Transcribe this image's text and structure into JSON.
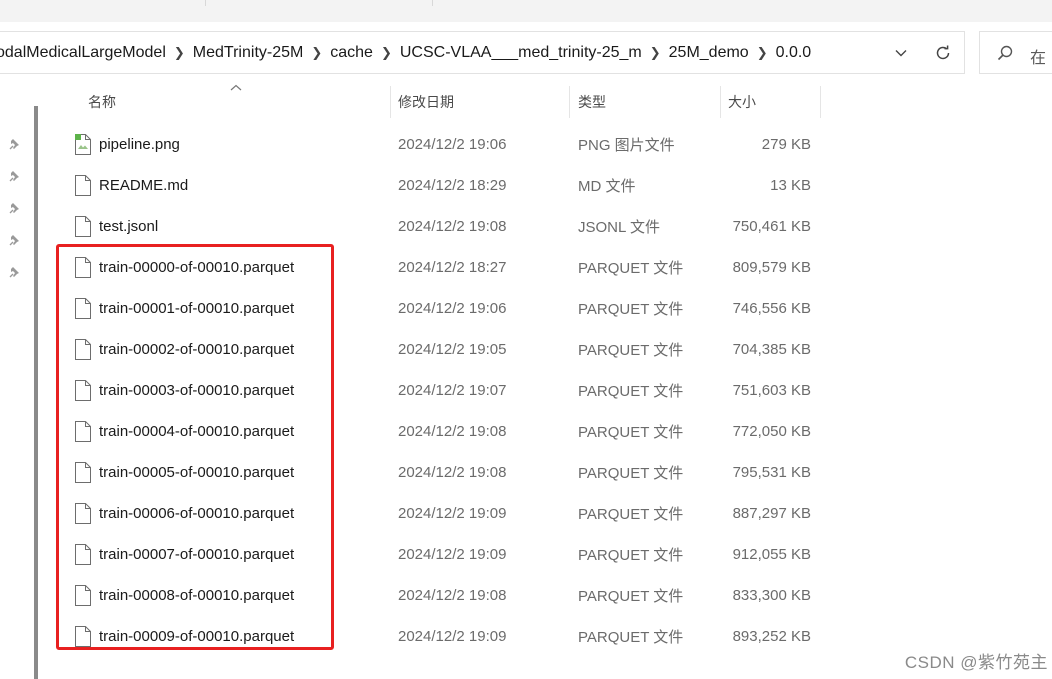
{
  "breadcrumb": [
    "odalMedicalLargeModel",
    "MedTrinity-25M",
    "cache",
    "UCSC-VLAA___med_trinity-25_m",
    "25M_demo",
    "0.0.0"
  ],
  "search": {
    "placeholder": "在"
  },
  "columns": {
    "name": "名称",
    "date": "修改日期",
    "type": "类型",
    "size": "大小"
  },
  "files": [
    {
      "icon": "image-file-icon",
      "name": "pipeline.png",
      "date": "2024/12/2 19:06",
      "type": "PNG 图片文件",
      "size": "279 KB"
    },
    {
      "icon": "document-file-icon",
      "name": "README.md",
      "date": "2024/12/2 18:29",
      "type": "MD 文件",
      "size": "13 KB"
    },
    {
      "icon": "document-file-icon",
      "name": "test.jsonl",
      "date": "2024/12/2 19:08",
      "type": "JSONL 文件",
      "size": "750,461 KB"
    },
    {
      "icon": "document-file-icon",
      "name": "train-00000-of-00010.parquet",
      "date": "2024/12/2 18:27",
      "type": "PARQUET 文件",
      "size": "809,579 KB"
    },
    {
      "icon": "document-file-icon",
      "name": "train-00001-of-00010.parquet",
      "date": "2024/12/2 19:06",
      "type": "PARQUET 文件",
      "size": "746,556 KB"
    },
    {
      "icon": "document-file-icon",
      "name": "train-00002-of-00010.parquet",
      "date": "2024/12/2 19:05",
      "type": "PARQUET 文件",
      "size": "704,385 KB"
    },
    {
      "icon": "document-file-icon",
      "name": "train-00003-of-00010.parquet",
      "date": "2024/12/2 19:07",
      "type": "PARQUET 文件",
      "size": "751,603 KB"
    },
    {
      "icon": "document-file-icon",
      "name": "train-00004-of-00010.parquet",
      "date": "2024/12/2 19:08",
      "type": "PARQUET 文件",
      "size": "772,050 KB"
    },
    {
      "icon": "document-file-icon",
      "name": "train-00005-of-00010.parquet",
      "date": "2024/12/2 19:08",
      "type": "PARQUET 文件",
      "size": "795,531 KB"
    },
    {
      "icon": "document-file-icon",
      "name": "train-00006-of-00010.parquet",
      "date": "2024/12/2 19:09",
      "type": "PARQUET 文件",
      "size": "887,297 KB"
    },
    {
      "icon": "document-file-icon",
      "name": "train-00007-of-00010.parquet",
      "date": "2024/12/2 19:09",
      "type": "PARQUET 文件",
      "size": "912,055 KB"
    },
    {
      "icon": "document-file-icon",
      "name": "train-00008-of-00010.parquet",
      "date": "2024/12/2 19:08",
      "type": "PARQUET 文件",
      "size": "833,300 KB"
    },
    {
      "icon": "document-file-icon",
      "name": "train-00009-of-00010.parquet",
      "date": "2024/12/2 19:09",
      "type": "PARQUET 文件",
      "size": "893,252 KB"
    }
  ],
  "highlight_color": "#e82020",
  "watermark": "CSDN @紫竹苑主"
}
